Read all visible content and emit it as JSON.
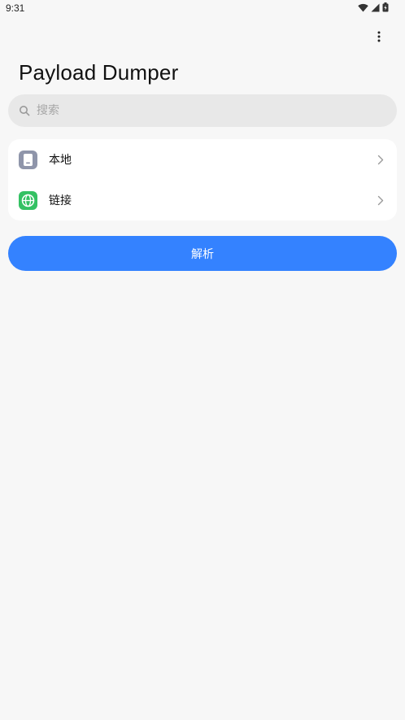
{
  "status_bar": {
    "time": "9:31",
    "icons": [
      "wifi-icon",
      "cellular-signal-icon",
      "battery-charging-icon"
    ]
  },
  "header": {
    "title": "Payload Dumper",
    "overflow_icon": "more-vertical-icon"
  },
  "search": {
    "placeholder": "搜索",
    "value": "",
    "icon": "search-icon"
  },
  "source_list": {
    "items": [
      {
        "label": "本地",
        "icon": "phone-storage-icon",
        "icon_color": "#8f95aa"
      },
      {
        "label": "链接",
        "icon": "globe-icon",
        "icon_color": "#34c163"
      }
    ],
    "trailing_icon": "chevron-right-icon"
  },
  "actions": {
    "parse_label": "解析",
    "accent_color": "#3482ff"
  }
}
